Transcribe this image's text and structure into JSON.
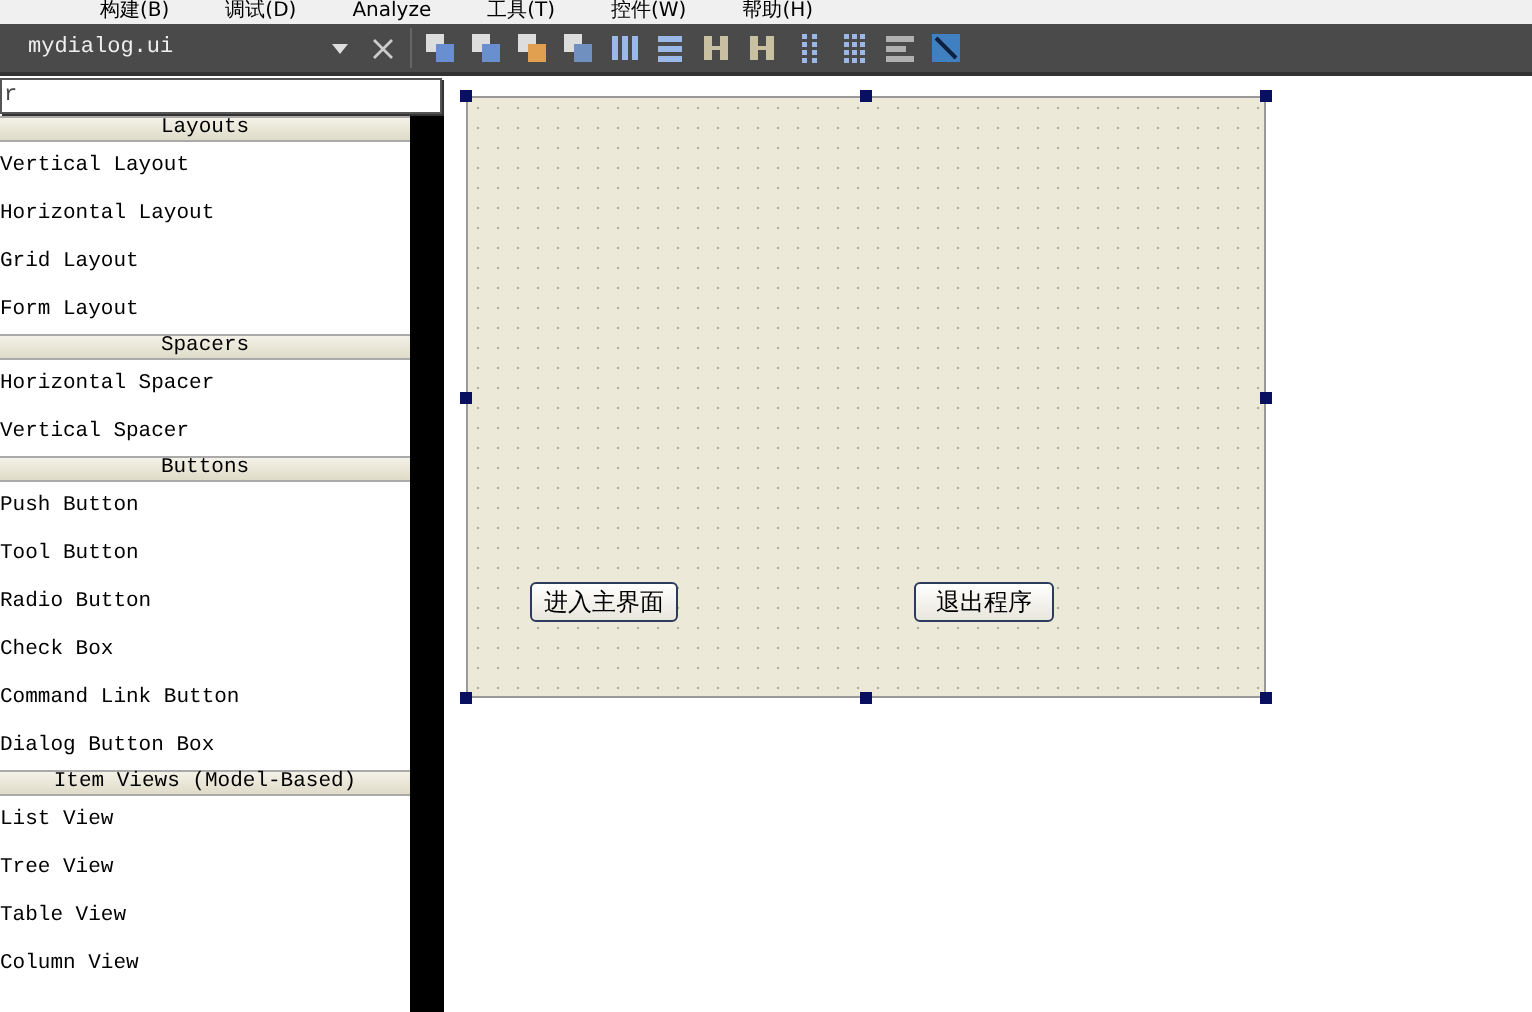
{
  "menu_bar": {
    "items": [
      "构建(B)",
      "调试(D)",
      "Analyze",
      "工具(T)",
      "控件(W)",
      "帮助(H)"
    ]
  },
  "file_selector": {
    "value": "mydialog.ui"
  },
  "toolbar": {
    "tools": [
      {
        "kind": "raise"
      },
      {
        "kind": "lower"
      },
      {
        "kind": "tab-order"
      },
      {
        "kind": "buddy"
      },
      {
        "kind": "hbox"
      },
      {
        "kind": "vbox"
      },
      {
        "kind": "hsplit"
      },
      {
        "kind": "vsplit"
      },
      {
        "kind": "form"
      },
      {
        "kind": "grid"
      },
      {
        "kind": "break"
      },
      {
        "kind": "adjust"
      }
    ]
  },
  "widget_box": {
    "filter": {
      "placeholder": "r"
    },
    "sections": [
      {
        "title": "Layouts",
        "items": [
          "Vertical Layout",
          "Horizontal Layout",
          "Grid Layout",
          "Form Layout"
        ]
      },
      {
        "title": "Spacers",
        "items": [
          "Horizontal Spacer",
          "Vertical Spacer"
        ]
      },
      {
        "title": "Buttons",
        "items": [
          "Push Button",
          "Tool Button",
          "Radio Button",
          "Check Box",
          "Command Link Button",
          "Dialog Button Box"
        ]
      },
      {
        "title": "Item Views (Model-Based)",
        "items": [
          "List View",
          "Tree View",
          "Table View",
          "Column View"
        ]
      }
    ]
  },
  "form": {
    "buttons": [
      "进入主界面",
      "退出程序"
    ]
  }
}
